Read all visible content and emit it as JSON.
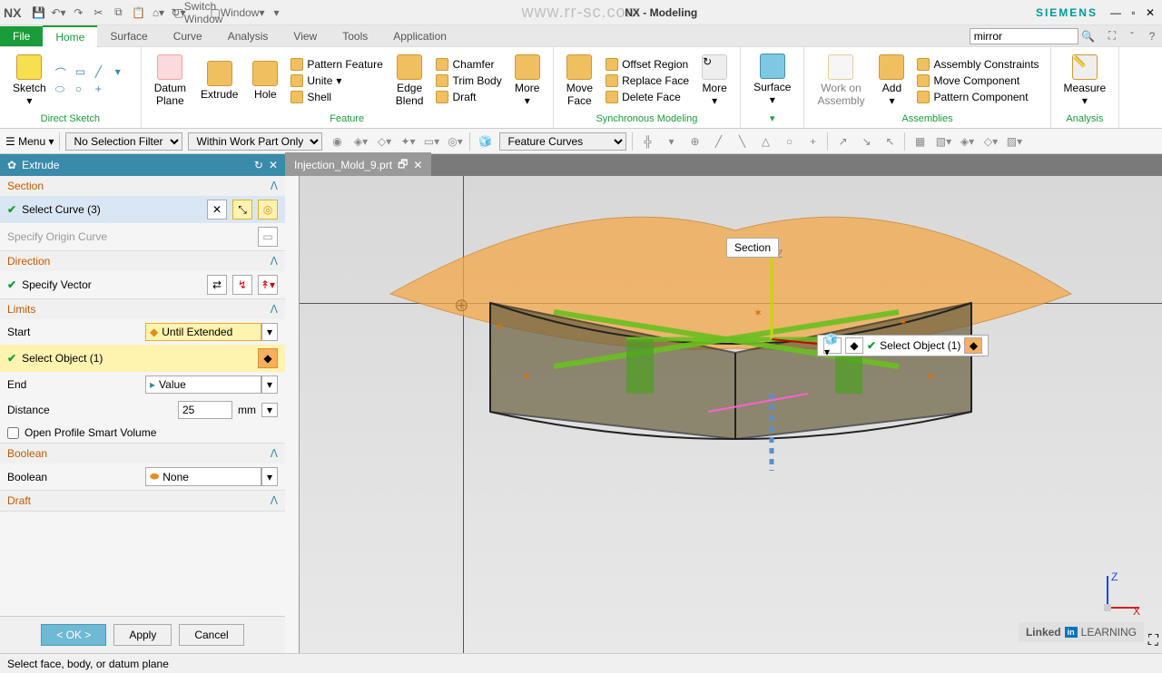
{
  "title": "NX - Modeling",
  "brand": "SIEMENS",
  "logo": "NX",
  "watermark_url": "www.rr-sc.com",
  "titlebar_buttons": {
    "switch_window": "Switch Window",
    "window": "Window"
  },
  "ribbon_tabs": [
    "File",
    "Home",
    "Surface",
    "Curve",
    "Analysis",
    "View",
    "Tools",
    "Application"
  ],
  "search_value": "mirror",
  "ribbon": {
    "direct_sketch": {
      "label": "Direct Sketch",
      "sketch": "Sketch"
    },
    "feature": {
      "label": "Feature",
      "datum_plane": "Datum\nPlane",
      "extrude": "Extrude",
      "hole": "Hole",
      "pattern": "Pattern Feature",
      "unite": "Unite",
      "shell": "Shell",
      "edge_blend": "Edge\nBlend",
      "chamfer": "Chamfer",
      "trim": "Trim Body",
      "draft": "Draft",
      "more": "More"
    },
    "sync": {
      "label": "Synchronous Modeling",
      "move_face": "Move\nFace",
      "offset": "Offset Region",
      "replace": "Replace Face",
      "delete": "Delete Face",
      "more": "More"
    },
    "surface": {
      "label": "",
      "btn": "Surface"
    },
    "assemblies": {
      "label": "Assemblies",
      "work_on": "Work on\nAssembly",
      "add": "Add",
      "constraints": "Assembly Constraints",
      "move_comp": "Move Component",
      "pattern_comp": "Pattern Component"
    },
    "analysis": {
      "label": "Analysis",
      "measure": "Measure"
    }
  },
  "selection_bar": {
    "menu": "Menu",
    "filter": "No Selection Filter",
    "scope": "Within Work Part Only",
    "feature_curves": "Feature Curves"
  },
  "doc_tab": "Injection_Mold_9.prt",
  "dialog": {
    "title": "Extrude",
    "sections": {
      "section": {
        "title": "Section",
        "select_curve": "Select Curve (3)",
        "origin": "Specify Origin Curve"
      },
      "direction": {
        "title": "Direction",
        "vector": "Specify Vector"
      },
      "limits": {
        "title": "Limits",
        "start": "Start",
        "start_val": "Until Extended",
        "select_obj": "Select Object (1)",
        "end": "End",
        "end_val": "Value",
        "distance": "Distance",
        "distance_val": "25",
        "distance_unit": "mm",
        "open_profile": "Open Profile Smart Volume"
      },
      "boolean": {
        "title": "Boolean",
        "label": "Boolean",
        "val": "None"
      },
      "draft": {
        "title": "Draft"
      }
    },
    "actions": {
      "ok": "< OK >",
      "apply": "Apply",
      "cancel": "Cancel"
    }
  },
  "viewport": {
    "section_label": "Section",
    "float_select": "Select Object (1)"
  },
  "statusbar": "Select face, body, or datum plane",
  "linkedin": "LEARNING"
}
